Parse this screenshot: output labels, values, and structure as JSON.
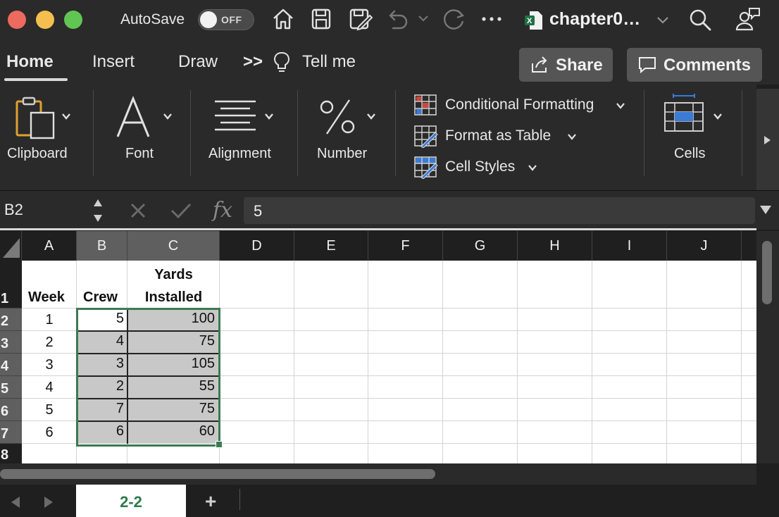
{
  "titlebar": {
    "autosave_label": "AutoSave",
    "autosave_state": "OFF",
    "document_title": "chapter0…"
  },
  "tabs": {
    "home": "Home",
    "insert": "Insert",
    "draw": "Draw",
    "more": ">>",
    "tell_me": "Tell me",
    "share": "Share",
    "comments": "Comments"
  },
  "ribbon": {
    "clipboard": "Clipboard",
    "font": "Font",
    "alignment": "Alignment",
    "number": "Number",
    "conditional_formatting": "Conditional Formatting",
    "format_as_table": "Format as Table",
    "cell_styles": "Cell Styles",
    "cells": "Cells"
  },
  "formula_bar": {
    "name_box": "B2",
    "fx": "fx",
    "value": "5"
  },
  "grid": {
    "columns": [
      "A",
      "B",
      "C",
      "D",
      "E",
      "F",
      "G",
      "H",
      "I",
      "J"
    ],
    "rows": [
      "1",
      "2",
      "3",
      "4",
      "5",
      "6",
      "7",
      "8"
    ],
    "header": {
      "week": "Week",
      "crew": "Crew",
      "yards_line1": "Yards",
      "yards_line2": "Installed"
    },
    "data": [
      {
        "week": "1",
        "crew": "5",
        "yards": "100"
      },
      {
        "week": "2",
        "crew": "4",
        "yards": "75"
      },
      {
        "week": "3",
        "crew": "3",
        "yards": "105"
      },
      {
        "week": "4",
        "crew": "2",
        "yards": "55"
      },
      {
        "week": "5",
        "crew": "7",
        "yards": "75"
      },
      {
        "week": "6",
        "crew": "6",
        "yards": "60"
      }
    ]
  },
  "sheets": {
    "active": "2-2",
    "add": "+"
  },
  "colors": {
    "selection_border": "#3b7a54",
    "sheet_tab_text": "#2f7a4e"
  }
}
